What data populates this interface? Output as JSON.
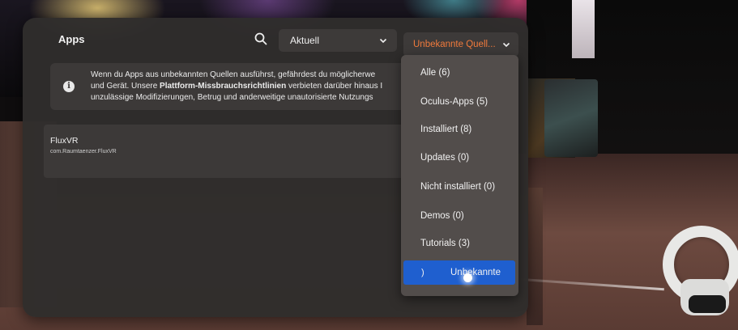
{
  "panel": {
    "title": "Apps"
  },
  "toolbar": {
    "search_icon": "search-icon",
    "sort_value": "Aktuell",
    "filter_value": "Unbekannte Quell...",
    "filter_color": "#f07a3c"
  },
  "notice": {
    "line1": "Wenn du Apps aus unbekannten Quellen ausführst, gefährdest du möglicherwe",
    "line2_pre": "und Gerät. Unsere ",
    "line2_bold": "Plattform-Missbrauchsrichtlinien",
    "line2_post": " verbieten darüber hinaus I",
    "line3": "unzulässige Modifizierungen, Betrug und anderweitige unautorisierte Nutzungs"
  },
  "app_list": [
    {
      "name": "FluxVR",
      "package": "com.Raumtaenzer.FluxVR"
    }
  ],
  "filter_menu": {
    "items": [
      {
        "label": "Alle (6)"
      },
      {
        "label": "Oculus-Apps (5)"
      },
      {
        "label": "Installiert (8)"
      },
      {
        "label": "Updates (0)"
      },
      {
        "label": "Nicht installiert (0)"
      },
      {
        "label": "Demos (0)"
      },
      {
        "label": "Tutorials (3)"
      }
    ],
    "selected": {
      "label": "Unbekannte",
      "check": ")"
    },
    "selected_color": "#1f5fcf"
  }
}
